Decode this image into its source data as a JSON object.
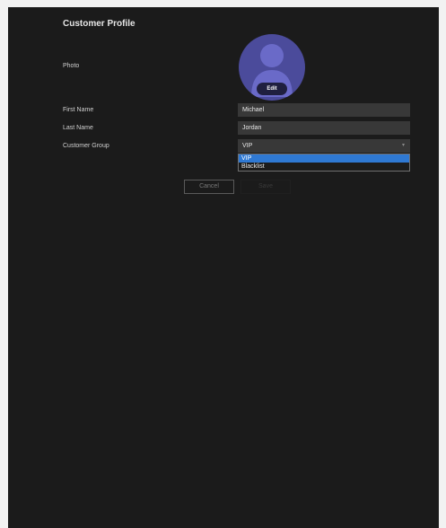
{
  "page": {
    "title": "Customer Profile"
  },
  "photo": {
    "label": "Photo",
    "edit_label": "Edit",
    "avatar_icon": "person-silhouette-icon",
    "avatar_color": "#4b4b9b"
  },
  "form": {
    "first_name_label": "First Name",
    "first_name_value": "Michael",
    "last_name_label": "Last Name",
    "last_name_value": "Jordan",
    "group_label": "Customer Group",
    "group_value": "VIP",
    "group_options": [
      "VIP",
      "Blacklist"
    ],
    "group_selected_index": 0
  },
  "actions": {
    "cancel_label": "Cancel",
    "save_label": "Save"
  },
  "colors": {
    "background": "#1b1b1b",
    "field_bg": "#383838",
    "selection": "#2f79d3"
  }
}
